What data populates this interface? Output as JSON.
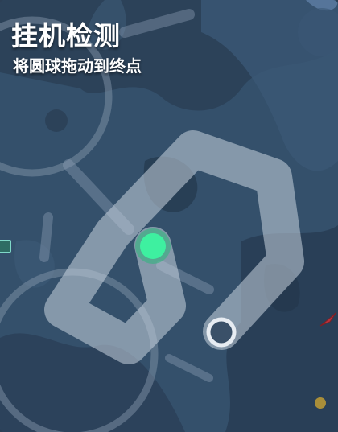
{
  "header": {
    "title": "挂机检测",
    "subtitle": "将圆球拖动到终点"
  },
  "colors": {
    "background": "#2f4660",
    "track": "#c9d3df",
    "ball": "#3ef0a0",
    "ball_ring": "#2ab87a",
    "goal_ring": "#e7ecf2",
    "arrow": "#b8323a",
    "coin": "#c9a232"
  },
  "icons": {
    "ball": "drag-ball",
    "goal": "goal-ring",
    "arrow": "red-arrow-icon",
    "coin": "coin-icon"
  }
}
